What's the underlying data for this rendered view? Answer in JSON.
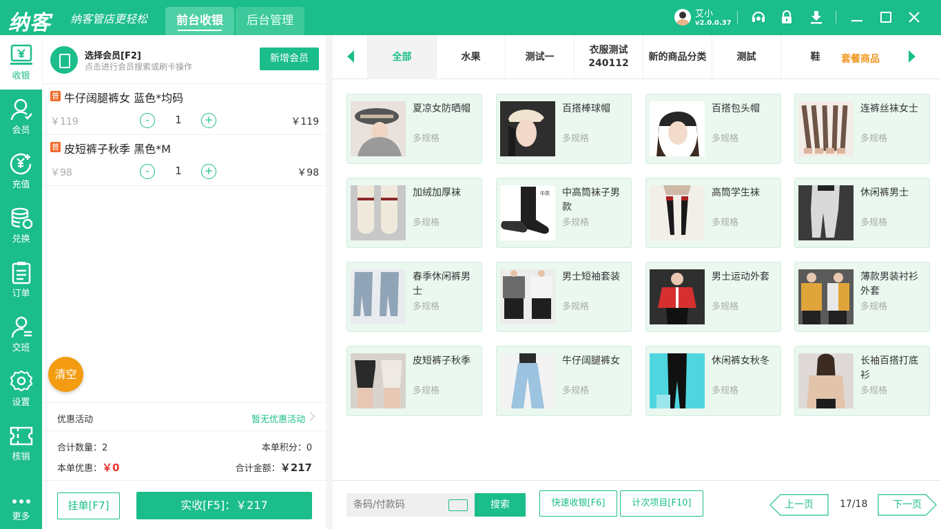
{
  "titlebar": {
    "logo": "纳客",
    "slogan": "纳客管店更轻松",
    "tabs": [
      {
        "label": "前台收银"
      },
      {
        "label": "后台管理"
      }
    ],
    "user": {
      "name": "艾小",
      "version": "v2.0.0.37"
    },
    "icons": [
      "headset-icon",
      "lock-icon",
      "download-icon",
      "minimize-icon",
      "maximize-icon",
      "close-icon"
    ]
  },
  "sidebar": {
    "items": [
      {
        "label": "收银",
        "icon": "cashier-icon"
      },
      {
        "label": "会员",
        "icon": "member-icon"
      },
      {
        "label": "充值",
        "icon": "recharge-icon"
      },
      {
        "label": "兑换",
        "icon": "exchange-icon"
      },
      {
        "label": "订单",
        "icon": "order-icon"
      },
      {
        "label": "交班",
        "icon": "shift-icon"
      },
      {
        "label": "设置",
        "icon": "settings-icon"
      },
      {
        "label": "核销",
        "icon": "ticket-icon"
      },
      {
        "label": "更多",
        "icon": "more-icon"
      }
    ]
  },
  "cart": {
    "member_title": "选择会员[F2]",
    "member_hint": "点击进行会员搜索或刷卡操作",
    "add_member": "新增会员",
    "items": [
      {
        "badge": "普",
        "name": "牛仔阔腿裤女 蓝色*均码",
        "price": "￥119",
        "minus": "-",
        "qty": "1",
        "plus": "+",
        "total": "￥119"
      },
      {
        "badge": "普",
        "name": "皮短裤子秋季 黑色*M",
        "price": "￥98",
        "minus": "-",
        "qty": "1",
        "plus": "+",
        "total": "￥98"
      }
    ],
    "clear": "清空",
    "promo_label": "优惠活动",
    "promo_value": "暂无优惠活动",
    "total_qty_label": "合计数量：",
    "total_qty": "2",
    "points_label": "本单积分：",
    "points": "0",
    "discount_label": "本单优惠：",
    "discount": "￥0",
    "amount_label": "合计金额：",
    "amount": "￥217",
    "hold": "挂单[F7]",
    "pay": "实收[F5]：￥217"
  },
  "products": {
    "categories": [
      {
        "label": "全部"
      },
      {
        "label": "水果"
      },
      {
        "label": "测试一"
      },
      {
        "label": "衣服测试240112"
      },
      {
        "label": "新的商品分类"
      },
      {
        "label": "测試"
      },
      {
        "label": "鞋"
      }
    ],
    "extra_category": "套餐商品",
    "items": [
      {
        "name": "夏凉女防晒帽",
        "spec": "多规格"
      },
      {
        "name": "百搭棒球帽",
        "spec": "多规格"
      },
      {
        "name": "百搭包头帽",
        "spec": "多规格"
      },
      {
        "name": "连裤丝袜女士",
        "spec": "多规格"
      },
      {
        "name": "加绒加厚袜",
        "spec": "多规格"
      },
      {
        "name": "中高筒袜子男款",
        "spec": "多规格"
      },
      {
        "name": "高筒学生袜",
        "spec": "多规格"
      },
      {
        "name": "休闲裤男士",
        "spec": "多规格"
      },
      {
        "name": "春季休闲裤男士",
        "spec": "多规格"
      },
      {
        "name": "男士短袖套装",
        "spec": "多规格"
      },
      {
        "name": "男士运动外套",
        "spec": "多规格"
      },
      {
        "name": "薄款男装衬衫外套",
        "spec": "多规格"
      },
      {
        "name": "皮短裤子秋季",
        "spec": "多规格"
      },
      {
        "name": "牛仔阔腿裤女",
        "spec": "多规格"
      },
      {
        "name": "休闲裤女秋冬",
        "spec": "多规格"
      },
      {
        "name": "长袖百搭打底衫",
        "spec": "多规格"
      }
    ],
    "search_placeholder": "条码/付款码",
    "search_btn": "搜索",
    "quick_pay": "快速收银[F6]",
    "count_items": "计次项目[F10]",
    "prev": "上一页",
    "next": "下一页",
    "page": "17/18"
  }
}
